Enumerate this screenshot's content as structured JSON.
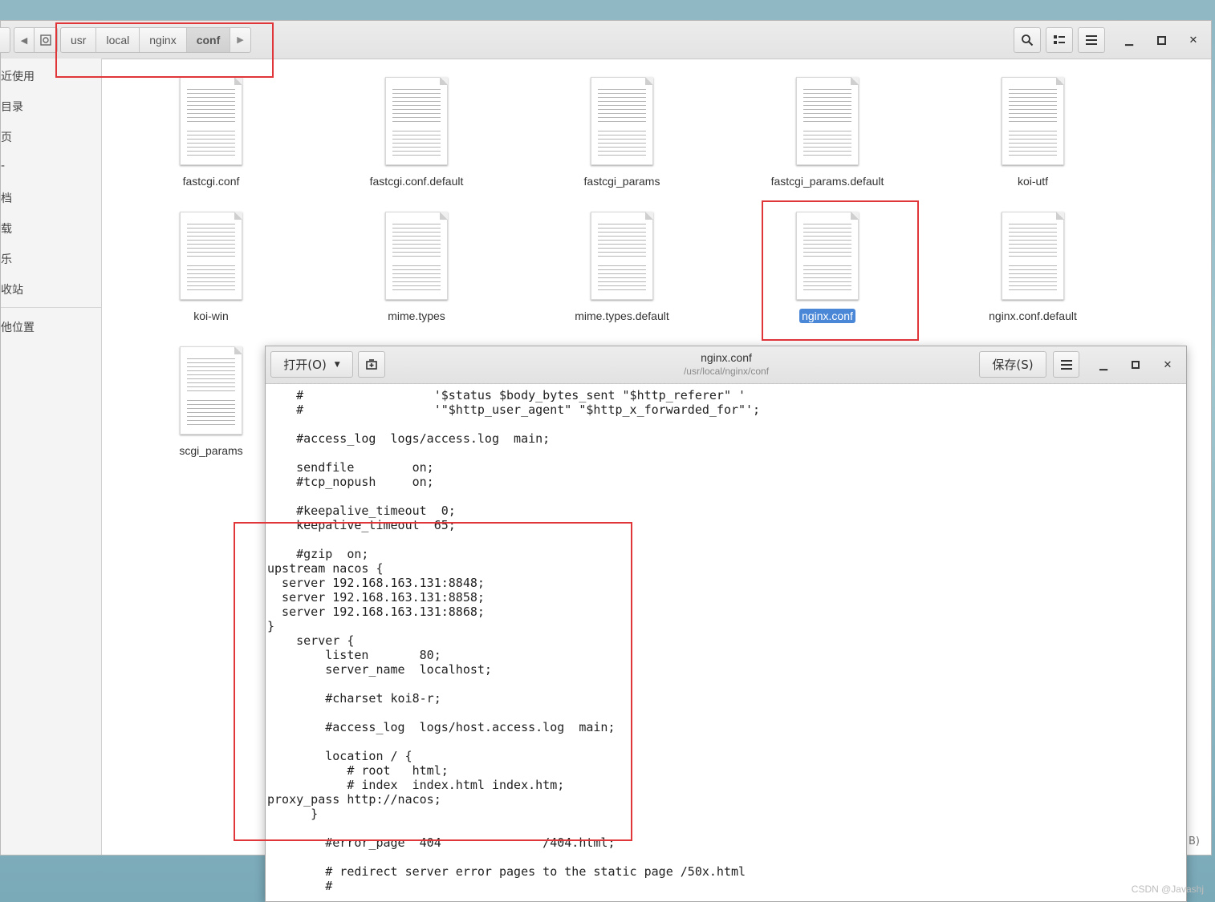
{
  "file_manager": {
    "path": [
      "usr",
      "local",
      "nginx",
      "conf"
    ],
    "active_crumb": "conf",
    "sidebar_items": [
      "近使用",
      "目录",
      "页",
      "-",
      "档",
      "载",
      "乐",
      "收站",
      "他位置"
    ],
    "files": [
      "fastcgi.conf",
      "fastcgi.conf.default",
      "fastcgi_params",
      "fastcgi_params.default",
      "koi-utf",
      "koi-win",
      "mime.types",
      "mime.types.default",
      "nginx.conf",
      "nginx.conf.default",
      "scgi_params"
    ],
    "selected_file": "nginx.conf",
    "status_peek": "B)"
  },
  "editor": {
    "title": "nginx.conf",
    "subtitle": "/usr/local/nginx/conf",
    "open_label": "打开(O)",
    "save_label": "保存(S)",
    "code": "    #                  '$status $body_bytes_sent \"$http_referer\" '\n    #                  '\"$http_user_agent\" \"$http_x_forwarded_for\"';\n\n    #access_log  logs/access.log  main;\n\n    sendfile        on;\n    #tcp_nopush     on;\n\n    #keepalive_timeout  0;\n    keepalive_timeout  65;\n\n    #gzip  on;\nupstream nacos {\n  server 192.168.163.131:8848;\n  server 192.168.163.131:8858;\n  server 192.168.163.131:8868;\n}\n    server {\n        listen       80;\n        server_name  localhost;\n\n        #charset koi8-r;\n\n        #access_log  logs/host.access.log  main;\n\n        location / {\n           # root   html;\n           # index  index.html index.htm;\nproxy_pass http://nacos;\n      }\n\n        #error_page  404              /404.html;\n\n        # redirect server error pages to the static page /50x.html\n        #"
  },
  "watermark": "CSDN @Javashj",
  "colors": {
    "annotation": "#e0363a",
    "selection": "#4a87d6"
  }
}
